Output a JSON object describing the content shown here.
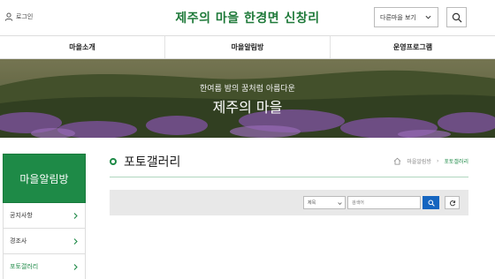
{
  "header": {
    "login_label": "로그인",
    "site_title": "제주의 마을 한경면 신창리",
    "village_select_label": "다른마을 보기"
  },
  "nav": {
    "items": [
      "마을소개",
      "마을알림방",
      "운영프로그램"
    ]
  },
  "hero": {
    "subtitle": "한여름 밤의 꿈처럼 아름다운",
    "title": "제주의 마을"
  },
  "sidebar": {
    "heading": "마을알림방",
    "items": [
      {
        "label": "공지사항",
        "active": false
      },
      {
        "label": "경조사",
        "active": false
      },
      {
        "label": "포토갤러리",
        "active": true
      }
    ]
  },
  "content": {
    "title": "포토갤러리",
    "breadcrumb": [
      "마을알림방",
      "포토갤러리"
    ]
  },
  "search": {
    "field_selected": "제목",
    "field_options": [
      "제목"
    ],
    "keyword_placeholder": "검색어"
  },
  "colors": {
    "brand_green": "#1e8a47",
    "search_blue": "#1565c0"
  }
}
